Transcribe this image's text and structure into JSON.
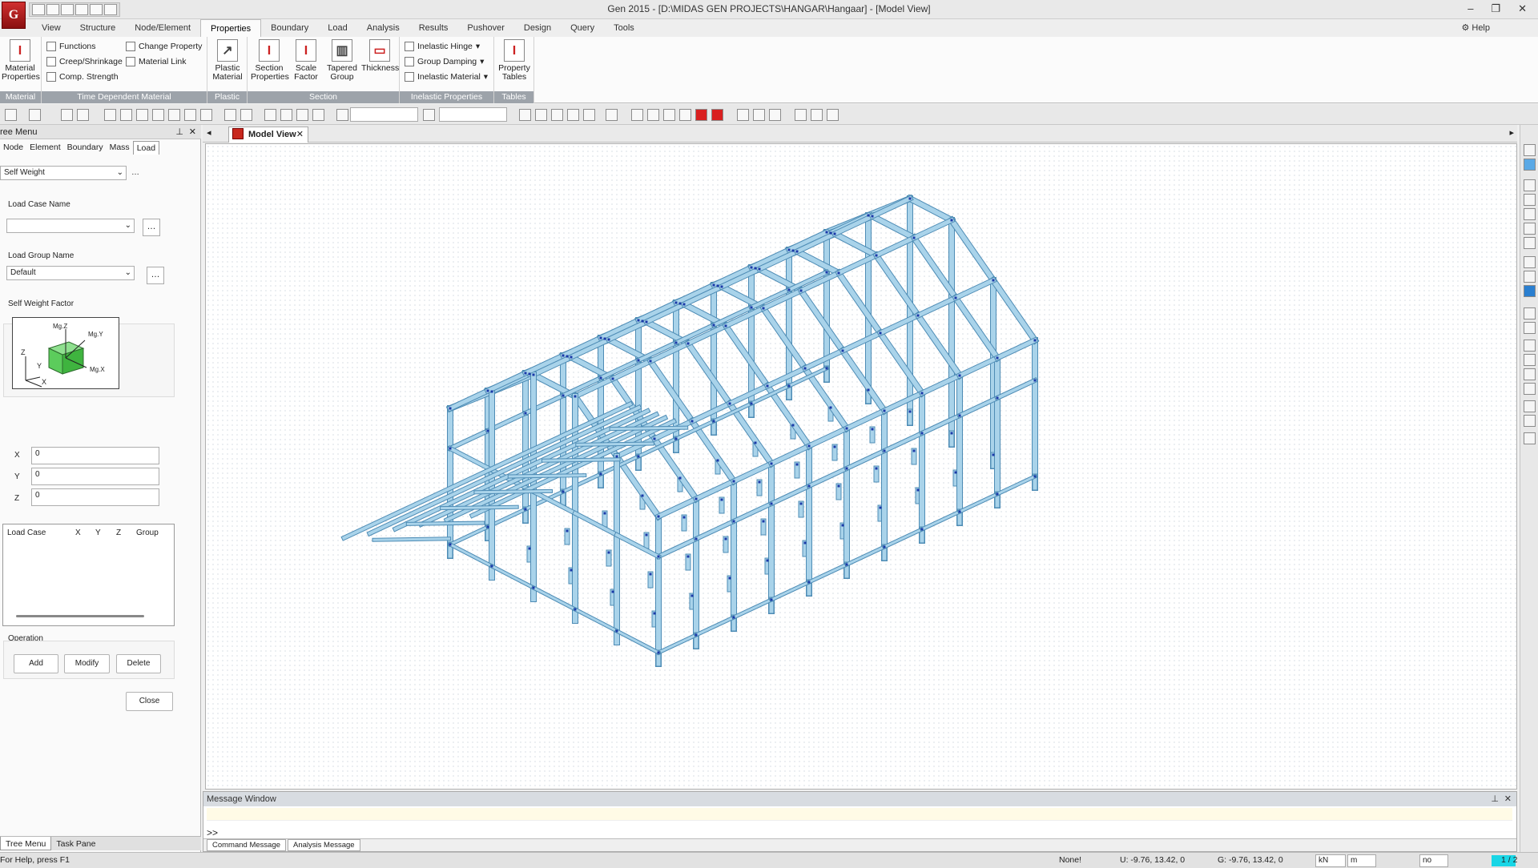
{
  "window": {
    "title": "Gen 2015 - [D:\\MIDAS GEN PROJECTS\\HANGAR\\Hangaar] - [Model View]",
    "logo_text": "G",
    "controls": [
      "–",
      "❐",
      "✕"
    ]
  },
  "menu": {
    "tabs": [
      "View",
      "Structure",
      "Node/Element",
      "Properties",
      "Boundary",
      "Load",
      "Analysis",
      "Results",
      "Pushover",
      "Design",
      "Query",
      "Tools"
    ],
    "active": "Properties",
    "help": "Help"
  },
  "ribbon": {
    "material": {
      "label": "Material",
      "btn": "Material Properties"
    },
    "time_dependent": {
      "label": "Time Dependent Material",
      "functions": "Functions",
      "creep": "Creep/Shrinkage",
      "comp": "Comp. Strength",
      "change_property": "Change Property",
      "material_link": "Material Link"
    },
    "plastic": {
      "label": "Plastic",
      "btn": "Plastic Material"
    },
    "section": {
      "label": "Section",
      "section_properties": "Section Properties",
      "scale_factor": "Scale Factor",
      "tapered_group": "Tapered Group",
      "thickness": "Thickness"
    },
    "inelastic": {
      "label": "Inelastic Properties",
      "hinge": "Inelastic Hinge",
      "damping": "Group Damping",
      "material": "Inelastic Material"
    },
    "tables": {
      "label": "Tables",
      "btn": "Property Tables"
    }
  },
  "tree": {
    "header": "ree Menu",
    "tabs": [
      "Node",
      "Element",
      "Boundary",
      "Mass",
      "Load"
    ],
    "active_tab": "Load",
    "load_type": "Self Weight",
    "load_case_label": "Load Case Name",
    "load_case_value": "",
    "load_group_label": "Load Group Name",
    "load_group_value": "Default",
    "factor_label": "Self Weight Factor",
    "diagram": {
      "mz": "Mg.Z",
      "my": "Mg.Y",
      "mx": "Mg.X",
      "z": "Z",
      "y": "Y",
      "x": "X"
    },
    "x_label": "X",
    "x_value": "0",
    "y_label": "Y",
    "y_value": "0",
    "z_label": "Z",
    "z_value": "0",
    "table_headers": [
      "Load Case",
      "X",
      "Y",
      "Z",
      "Group"
    ],
    "operation_label": "Operation",
    "add": "Add",
    "modify": "Modify",
    "delete": "Delete",
    "close": "Close",
    "bottom_tabs": [
      "Tree Menu",
      "Task Pane"
    ]
  },
  "view": {
    "tab": "Model View"
  },
  "message_window": {
    "title": "Message Window",
    "prompt": ">>",
    "tabs": [
      "Command Message",
      "Analysis Message"
    ]
  },
  "status": {
    "help": "For Help, press F1",
    "selection": "None!",
    "u_coord": "U: -9.76, 13.42, 0",
    "g_coord": "G: -9.76, 13.42, 0",
    "force_unit": "kN",
    "length_unit": "m",
    "mode": "no",
    "page": "1 / 2"
  },
  "colors": {
    "member": "#a9d3ea",
    "member_edge": "#4e8cb5",
    "node": "#1a3aa8",
    "ribbon_group_label": "#9da3aa",
    "accent_red": "#c8281e"
  }
}
